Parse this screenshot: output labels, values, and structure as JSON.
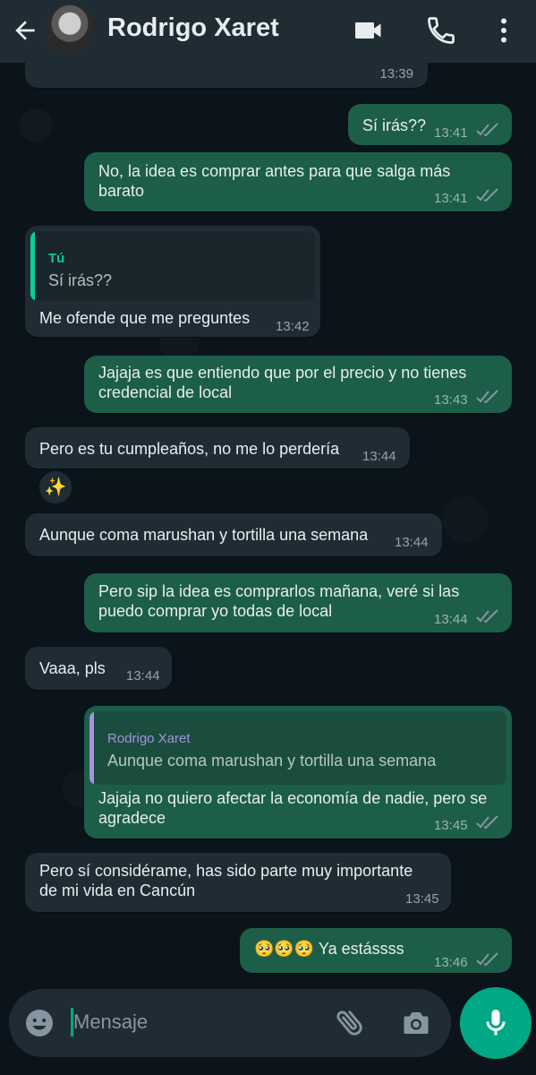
{
  "header": {
    "contact_name": "Rodrigo Xaret"
  },
  "messages": [
    {
      "id": "m0",
      "direction": "in",
      "time": "13:39"
    },
    {
      "id": "m1",
      "direction": "out",
      "text": "Sí irás??",
      "time": "13:41",
      "status": "read"
    },
    {
      "id": "m2",
      "direction": "out",
      "text_lines": [
        "No, la idea es comprar antes para que salga más",
        "barato"
      ],
      "time": "13:41",
      "status": "read"
    },
    {
      "id": "m3",
      "direction": "in",
      "quote": {
        "author": "Tú",
        "text": "Sí irás??"
      },
      "text": "Me ofende que me preguntes",
      "time": "13:42"
    },
    {
      "id": "m4",
      "direction": "out",
      "text_lines": [
        "Jajaja es que entiendo que por el precio y no tienes",
        "credencial de local"
      ],
      "time": "13:43",
      "status": "read"
    },
    {
      "id": "m5",
      "direction": "in",
      "text": "Pero es tu cumpleaños, no me lo perdería",
      "time": "13:44",
      "reaction": "✨"
    },
    {
      "id": "m6",
      "direction": "in",
      "text": "Aunque coma marushan y tortilla una semana",
      "time": "13:44"
    },
    {
      "id": "m7",
      "direction": "out",
      "text_lines": [
        "Pero sip la idea es comprarlos mañana, veré si las",
        "puedo comprar yo todas de local"
      ],
      "time": "13:44",
      "status": "read"
    },
    {
      "id": "m8",
      "direction": "in",
      "text": "Vaaa, pls",
      "time": "13:44"
    },
    {
      "id": "m9",
      "direction": "out",
      "quote": {
        "author": "Rodrigo Xaret",
        "text": "Aunque coma marushan y tortilla una semana"
      },
      "text_lines": [
        "Jajaja no quiero afectar la economía de nadie, pero se",
        "agradece"
      ],
      "time": "13:45",
      "status": "read"
    },
    {
      "id": "m10",
      "direction": "in",
      "text_lines": [
        "Pero sí considérame, has sido parte muy importante",
        "de mi vida en Cancún"
      ],
      "time": "13:45"
    },
    {
      "id": "m11",
      "direction": "out",
      "text": "🥺🥺🥺 Ya estássss",
      "time": "13:46",
      "status": "read"
    }
  ],
  "composer": {
    "placeholder": "Mensaje"
  },
  "icons": {
    "back": "back-arrow-icon",
    "video": "video-call-icon",
    "call": "phone-icon",
    "menu": "more-vert-icon",
    "emoji": "emoji-icon",
    "attach": "paperclip-icon",
    "camera": "camera-icon",
    "mic": "microphone-icon"
  },
  "colors": {
    "background": "#0b141a",
    "header": "#1f2c34",
    "incoming": "#1f2c34",
    "outgoing": "#1c5e48",
    "accent": "#00a884",
    "read_ticks": "#8696a0",
    "quote_self": "#06cf9c",
    "quote_other": "#a593e0"
  }
}
